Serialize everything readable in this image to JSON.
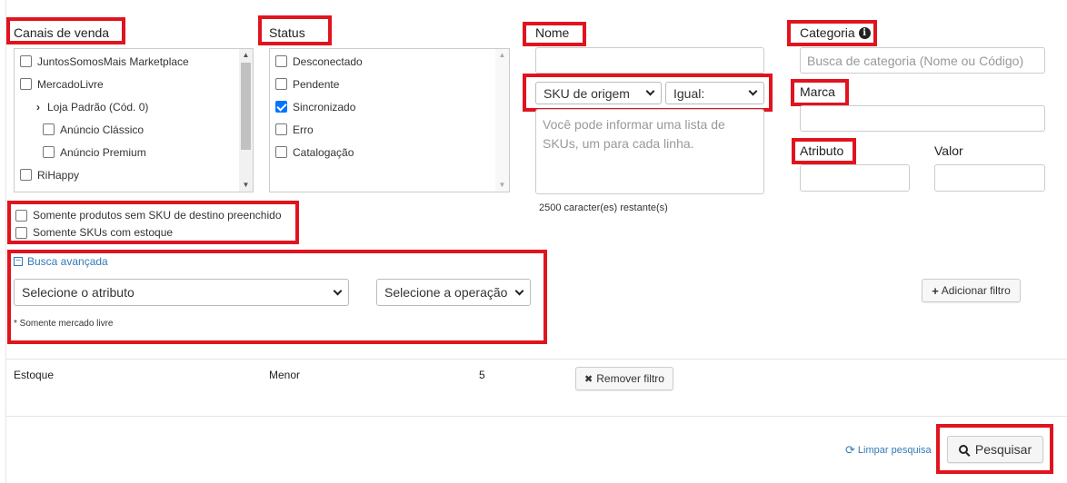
{
  "colors": {
    "highlight": "#e0141e",
    "link": "#337ab7",
    "checkbox_checked": "#0075ff"
  },
  "channels": {
    "label": "Canais de venda",
    "items": [
      "JuntosSomosMais Marketplace",
      "MercadoLivre",
      "Loja Padrão (Cód. 0)",
      "Anúncio Clássico",
      "Anúncio Premium",
      "RiHappy"
    ]
  },
  "status": {
    "label": "Status",
    "items": [
      "Desconectado",
      "Pendente",
      "Sincronizado",
      "Erro",
      "Catalogação"
    ],
    "checked_index": 2
  },
  "name": {
    "label": "Nome",
    "sku_select": "SKU de origem",
    "compare_select": "Igual:",
    "textarea_placeholder": "Você pode informar uma lista de SKUs, um para cada linha.",
    "char_count": "2500 caracter(es) restante(s)"
  },
  "category": {
    "label": "Categoria",
    "icon": "info-icon",
    "placeholder": "Busca de categoria (Nome ou Código)"
  },
  "brand": {
    "label": "Marca"
  },
  "attribute": {
    "label": "Atributo",
    "value_label": "Valor"
  },
  "options": {
    "no_dest_sku": "Somente produtos sem SKU de destino preenchido",
    "with_stock": "Somente SKUs com estoque"
  },
  "advanced": {
    "toggle_label": "Busca avançada",
    "attribute_select": "Selecione o atributo",
    "operation_select": "Selecione a operação",
    "note": "* Somente mercado livre",
    "add_filter": "Adicionar filtro"
  },
  "filter_row": {
    "field": "Estoque",
    "operator": "Menor",
    "value": "5",
    "remove_label": "Remover filtro"
  },
  "footer": {
    "clear_label": "Limpar pesquisa",
    "search_label": "Pesquisar"
  }
}
